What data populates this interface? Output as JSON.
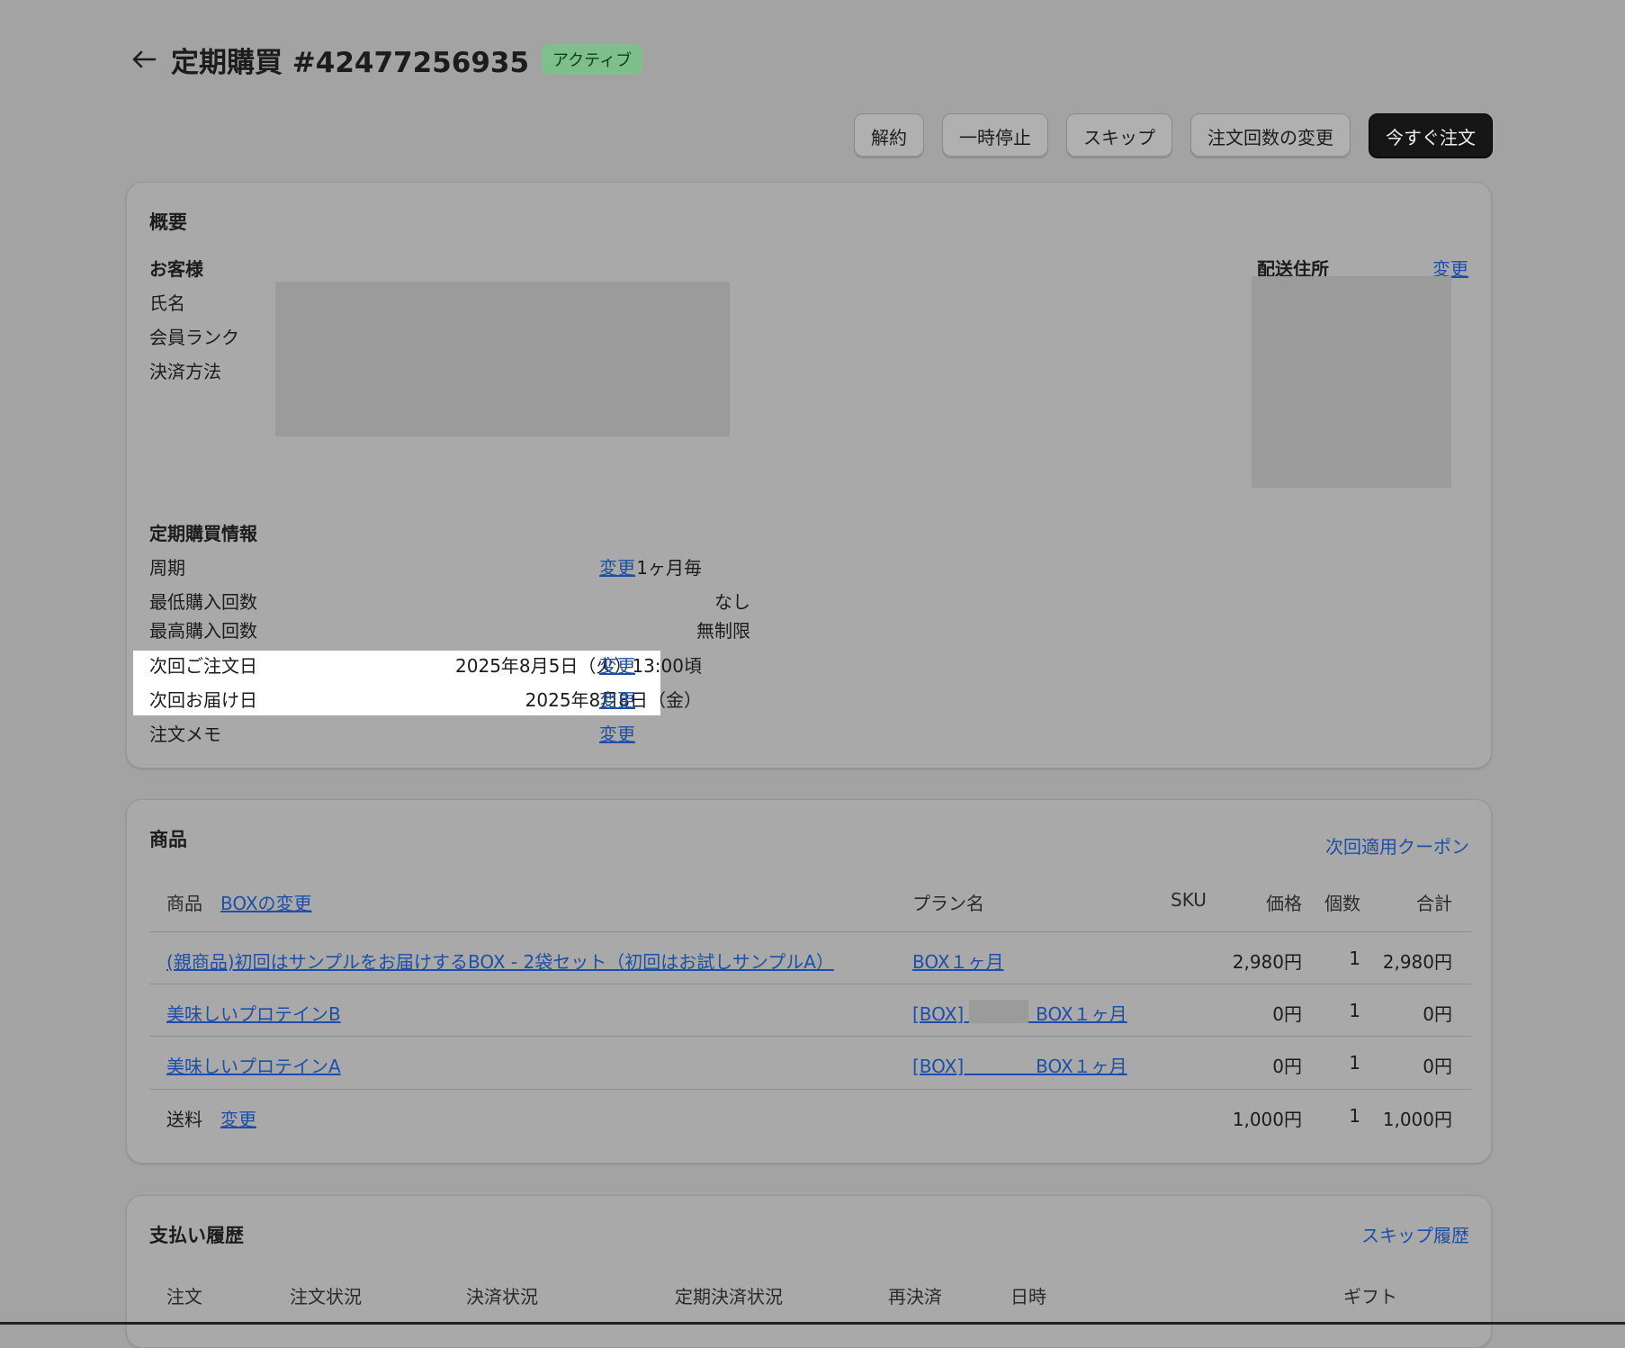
{
  "header": {
    "title": "定期購買 #42477256935",
    "status": "アクティブ"
  },
  "actions": {
    "cancel": "解約",
    "pause": "一時停止",
    "skip": "スキップ",
    "change_count": "注文回数の変更",
    "order_now": "今すぐ注文"
  },
  "overview": {
    "title": "概要",
    "customer": {
      "title": "お客様",
      "name_label": "氏名",
      "rank_label": "会員ランク",
      "payment_label": "決済方法"
    },
    "shipping": {
      "title": "配送住所",
      "change": "変更"
    },
    "subscription": {
      "title": "定期購買情報",
      "cycle_label": "周期",
      "cycle_value": "1ヶ月毎",
      "cycle_change": "変更",
      "min_label": "最低購入回数",
      "min_value": "なし",
      "max_label": "最高購入回数",
      "max_value": "無制限",
      "next_order_label": "次回ご注文日",
      "next_order_value": "2025年8月5日（火）13:00頃",
      "next_order_change": "変更",
      "next_delivery_label": "次回お届け日",
      "next_delivery_value": "2025年8月8日（金）",
      "next_delivery_change": "変更",
      "memo_label": "注文メモ",
      "memo_change": "変更"
    }
  },
  "products": {
    "title": "商品",
    "coupon_link": "次回適用クーポン",
    "headers": {
      "product": "商品",
      "box_change": "BOXの変更",
      "plan": "プラン名",
      "sku": "SKU",
      "price": "価格",
      "qty": "個数",
      "total": "合計"
    },
    "rows": [
      {
        "product": "(親商品)初回はサンプルをお届けするBOX - 2袋セット（初回はお試しサンプルA）",
        "plan": "BOX１ヶ月",
        "sku": "",
        "price": "2,980円",
        "qty": "1",
        "total": "2,980円"
      },
      {
        "product": "美味しいプロテインB",
        "plan": "[BOX]　　　　BOX１ヶ月",
        "sku": "",
        "price": "0円",
        "qty": "1",
        "total": "0円"
      },
      {
        "product": "美味しいプロテインA",
        "plan": "[BOX]　　　　BOX１ヶ月",
        "sku": "",
        "price": "0円",
        "qty": "1",
        "total": "0円"
      }
    ],
    "shipping_row": {
      "label": "送料",
      "change": "変更",
      "price": "1,000円",
      "qty": "1",
      "total": "1,000円"
    }
  },
  "payments": {
    "title": "支払い履歴",
    "skip_history": "スキップ履歴",
    "headers": {
      "order": "注文",
      "order_status": "注文状況",
      "payment_status": "決済状況",
      "recurring_status": "定期決済状況",
      "retry": "再決済",
      "datetime": "日時",
      "gift": "ギフト"
    }
  }
}
